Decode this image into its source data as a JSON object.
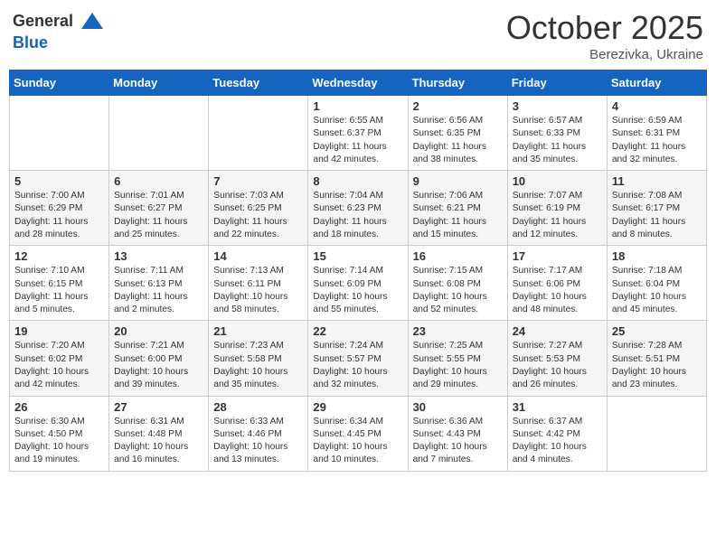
{
  "header": {
    "logo_line1": "General",
    "logo_line2": "Blue",
    "month": "October 2025",
    "location": "Berezivka, Ukraine"
  },
  "days_of_week": [
    "Sunday",
    "Monday",
    "Tuesday",
    "Wednesday",
    "Thursday",
    "Friday",
    "Saturday"
  ],
  "weeks": [
    [
      {
        "day": "",
        "info": ""
      },
      {
        "day": "",
        "info": ""
      },
      {
        "day": "",
        "info": ""
      },
      {
        "day": "1",
        "info": "Sunrise: 6:55 AM\nSunset: 6:37 PM\nDaylight: 11 hours and 42 minutes."
      },
      {
        "day": "2",
        "info": "Sunrise: 6:56 AM\nSunset: 6:35 PM\nDaylight: 11 hours and 38 minutes."
      },
      {
        "day": "3",
        "info": "Sunrise: 6:57 AM\nSunset: 6:33 PM\nDaylight: 11 hours and 35 minutes."
      },
      {
        "day": "4",
        "info": "Sunrise: 6:59 AM\nSunset: 6:31 PM\nDaylight: 11 hours and 32 minutes."
      }
    ],
    [
      {
        "day": "5",
        "info": "Sunrise: 7:00 AM\nSunset: 6:29 PM\nDaylight: 11 hours and 28 minutes."
      },
      {
        "day": "6",
        "info": "Sunrise: 7:01 AM\nSunset: 6:27 PM\nDaylight: 11 hours and 25 minutes."
      },
      {
        "day": "7",
        "info": "Sunrise: 7:03 AM\nSunset: 6:25 PM\nDaylight: 11 hours and 22 minutes."
      },
      {
        "day": "8",
        "info": "Sunrise: 7:04 AM\nSunset: 6:23 PM\nDaylight: 11 hours and 18 minutes."
      },
      {
        "day": "9",
        "info": "Sunrise: 7:06 AM\nSunset: 6:21 PM\nDaylight: 11 hours and 15 minutes."
      },
      {
        "day": "10",
        "info": "Sunrise: 7:07 AM\nSunset: 6:19 PM\nDaylight: 11 hours and 12 minutes."
      },
      {
        "day": "11",
        "info": "Sunrise: 7:08 AM\nSunset: 6:17 PM\nDaylight: 11 hours and 8 minutes."
      }
    ],
    [
      {
        "day": "12",
        "info": "Sunrise: 7:10 AM\nSunset: 6:15 PM\nDaylight: 11 hours and 5 minutes."
      },
      {
        "day": "13",
        "info": "Sunrise: 7:11 AM\nSunset: 6:13 PM\nDaylight: 11 hours and 2 minutes."
      },
      {
        "day": "14",
        "info": "Sunrise: 7:13 AM\nSunset: 6:11 PM\nDaylight: 10 hours and 58 minutes."
      },
      {
        "day": "15",
        "info": "Sunrise: 7:14 AM\nSunset: 6:09 PM\nDaylight: 10 hours and 55 minutes."
      },
      {
        "day": "16",
        "info": "Sunrise: 7:15 AM\nSunset: 6:08 PM\nDaylight: 10 hours and 52 minutes."
      },
      {
        "day": "17",
        "info": "Sunrise: 7:17 AM\nSunset: 6:06 PM\nDaylight: 10 hours and 48 minutes."
      },
      {
        "day": "18",
        "info": "Sunrise: 7:18 AM\nSunset: 6:04 PM\nDaylight: 10 hours and 45 minutes."
      }
    ],
    [
      {
        "day": "19",
        "info": "Sunrise: 7:20 AM\nSunset: 6:02 PM\nDaylight: 10 hours and 42 minutes."
      },
      {
        "day": "20",
        "info": "Sunrise: 7:21 AM\nSunset: 6:00 PM\nDaylight: 10 hours and 39 minutes."
      },
      {
        "day": "21",
        "info": "Sunrise: 7:23 AM\nSunset: 5:58 PM\nDaylight: 10 hours and 35 minutes."
      },
      {
        "day": "22",
        "info": "Sunrise: 7:24 AM\nSunset: 5:57 PM\nDaylight: 10 hours and 32 minutes."
      },
      {
        "day": "23",
        "info": "Sunrise: 7:25 AM\nSunset: 5:55 PM\nDaylight: 10 hours and 29 minutes."
      },
      {
        "day": "24",
        "info": "Sunrise: 7:27 AM\nSunset: 5:53 PM\nDaylight: 10 hours and 26 minutes."
      },
      {
        "day": "25",
        "info": "Sunrise: 7:28 AM\nSunset: 5:51 PM\nDaylight: 10 hours and 23 minutes."
      }
    ],
    [
      {
        "day": "26",
        "info": "Sunrise: 6:30 AM\nSunset: 4:50 PM\nDaylight: 10 hours and 19 minutes."
      },
      {
        "day": "27",
        "info": "Sunrise: 6:31 AM\nSunset: 4:48 PM\nDaylight: 10 hours and 16 minutes."
      },
      {
        "day": "28",
        "info": "Sunrise: 6:33 AM\nSunset: 4:46 PM\nDaylight: 10 hours and 13 minutes."
      },
      {
        "day": "29",
        "info": "Sunrise: 6:34 AM\nSunset: 4:45 PM\nDaylight: 10 hours and 10 minutes."
      },
      {
        "day": "30",
        "info": "Sunrise: 6:36 AM\nSunset: 4:43 PM\nDaylight: 10 hours and 7 minutes."
      },
      {
        "day": "31",
        "info": "Sunrise: 6:37 AM\nSunset: 4:42 PM\nDaylight: 10 hours and 4 minutes."
      },
      {
        "day": "",
        "info": ""
      }
    ]
  ]
}
